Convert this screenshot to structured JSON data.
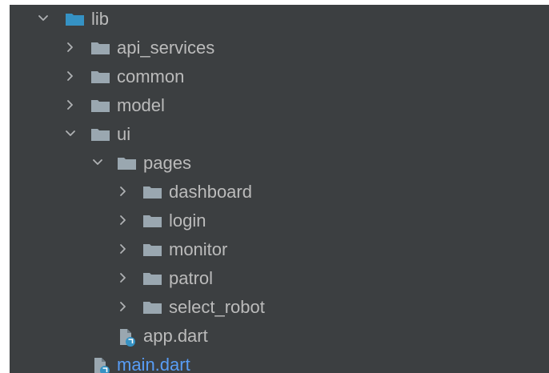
{
  "colors": {
    "panel_bg": "#3c3f41",
    "text": "#bbbbbb",
    "link_text": "#589df6",
    "folder_blue": "#3592c4",
    "folder_gray": "#9aa7b0",
    "chevron": "#afb1b3"
  },
  "tree": {
    "lib": {
      "label": "lib",
      "state": "expanded",
      "icon": "folder-blue-icon"
    },
    "api_services": {
      "label": "api_services",
      "state": "collapsed",
      "icon": "folder-icon"
    },
    "common": {
      "label": "common",
      "state": "collapsed",
      "icon": "folder-icon"
    },
    "model": {
      "label": "model",
      "state": "collapsed",
      "icon": "folder-icon"
    },
    "ui": {
      "label": "ui",
      "state": "expanded",
      "icon": "folder-icon"
    },
    "pages": {
      "label": "pages",
      "state": "expanded",
      "icon": "folder-icon"
    },
    "dashboard": {
      "label": "dashboard",
      "state": "collapsed",
      "icon": "folder-icon"
    },
    "login": {
      "label": "login",
      "state": "collapsed",
      "icon": "folder-icon"
    },
    "monitor": {
      "label": "monitor",
      "state": "collapsed",
      "icon": "folder-icon"
    },
    "patrol": {
      "label": "patrol",
      "state": "collapsed",
      "icon": "folder-icon"
    },
    "select_robot": {
      "label": "select_robot",
      "state": "collapsed",
      "icon": "folder-icon"
    },
    "app_dart": {
      "label": "app.dart",
      "icon": "dart-file-icon"
    },
    "main_dart": {
      "label": "main.dart",
      "icon": "dart-file-icon"
    }
  }
}
